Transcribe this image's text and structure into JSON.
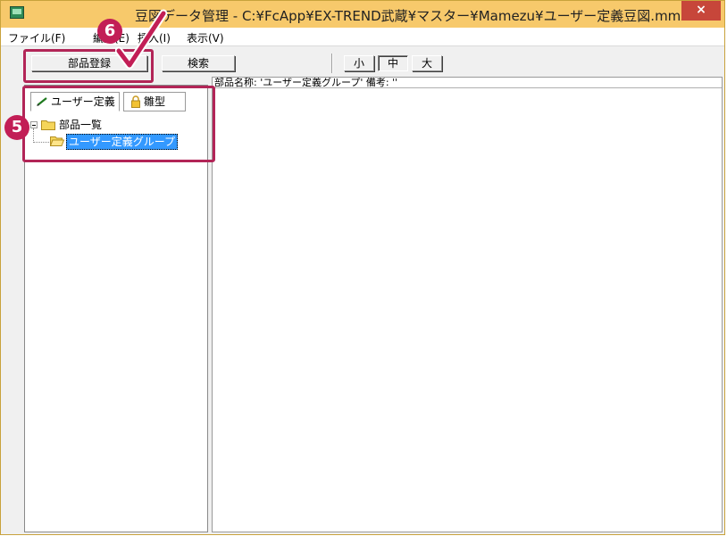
{
  "window": {
    "title": "豆図データ管理 - C:¥FcApp¥EX-TREND武蔵¥マスター¥Mamezu¥ユーザー定義豆図.mmz",
    "close_label": "×"
  },
  "menu": {
    "items": [
      {
        "label": "ファイル(F)"
      },
      {
        "label": "編集(E)"
      },
      {
        "label": "挿入(I)"
      },
      {
        "label": "表示(V)"
      }
    ]
  },
  "toolbar": {
    "register_label": "部品登録",
    "search_label": "検索",
    "size_small": "小",
    "size_medium": "中",
    "size_large": "大"
  },
  "left_panel": {
    "tabs": [
      {
        "label": "ユーザー定義",
        "icon": "pencil-icon"
      },
      {
        "label": "雛型",
        "icon": "lock-icon"
      }
    ],
    "tree": {
      "root_label": "部品一覧",
      "child_label": "ユーザー定義グループ"
    }
  },
  "right_panel": {
    "info_text": "部品名称: 'ユーザー定義グループ'  備考: ''"
  },
  "annotations": {
    "step5": "5",
    "step6": "6",
    "accent_color": "#c21e56"
  }
}
